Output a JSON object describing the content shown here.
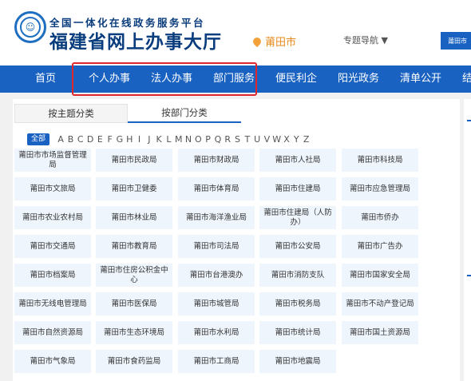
{
  "header": {
    "portal_subtitle": "全国一体化在线政务服务平台",
    "portal_title": "福建省网上办事大厅",
    "emblem_icon": "fujian-emblem-icon",
    "location_icon": "location-pin-icon",
    "location": "莆田市",
    "topic_nav": "专题导航 ▼",
    "city_button": "莆田市"
  },
  "nav": {
    "items": [
      "首页",
      "个人办事",
      "法人办事",
      "部门服务",
      "便民利企",
      "阳光政务",
      "清单公开",
      "结"
    ],
    "highlight_color": "#e0262b",
    "bar_color": "#1a62c2"
  },
  "tabs": [
    "按主题分类",
    "按部门分类"
  ],
  "letters": {
    "all": "全部",
    "list": [
      "A",
      "B",
      "C",
      "D",
      "E",
      "F",
      "G",
      "H",
      "I",
      "J",
      "K",
      "L",
      "M",
      "N",
      "O",
      "P",
      "Q",
      "R",
      "S",
      "T",
      "U",
      "V",
      "W",
      "X",
      "Y",
      "Z"
    ]
  },
  "departments": [
    [
      "莆田市市场监督管理局",
      "莆田市民政局",
      "莆田市财政局",
      "莆田市人社局",
      "莆田市科技局"
    ],
    [
      "莆田市文旅局",
      "莆田市卫健委",
      "莆田市体育局",
      "莆田市住建局",
      "莆田市应急管理局"
    ],
    [
      "莆田市农业农村局",
      "莆田市林业局",
      "莆田市海洋渔业局",
      "莆田市住建局（人防办）",
      "莆田市侨办"
    ],
    [
      "莆田市交通局",
      "莆田市教育局",
      "莆田市司法局",
      "莆田市公安局",
      "莆田市广告办"
    ],
    [
      "莆田市档案局",
      "莆田市住房公积金中心",
      "莆田市台港澳办",
      "莆田市消防支队",
      "莆田市国家安全局"
    ],
    [
      "莆田市无线电管理局",
      "莆田市医保局",
      "莆田市城管局",
      "莆田市税务局",
      "莆田市不动产登记局"
    ],
    [
      "莆田市自然资源局",
      "莆田市生态环境局",
      "莆田市水利局",
      "莆田市统计局",
      "莆田市国土资源局"
    ],
    [
      "莆田市气象局",
      "莆田市食药监局",
      "莆田市工商局",
      "莆田市地震局"
    ]
  ]
}
